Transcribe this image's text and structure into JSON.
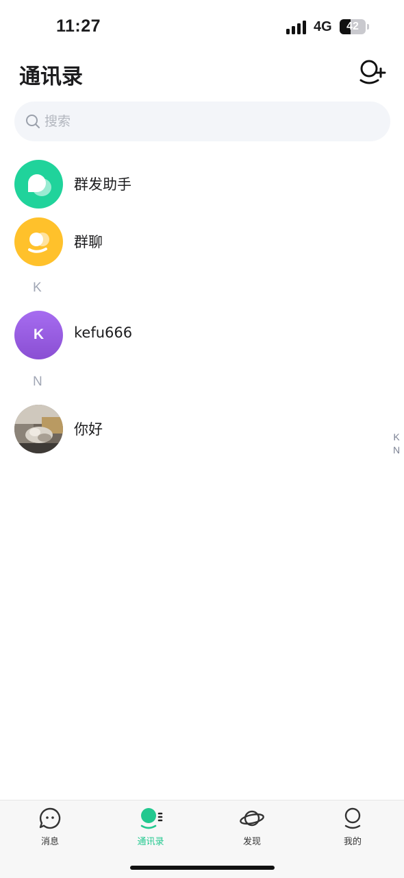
{
  "status_bar": {
    "time": "11:27",
    "network": "4G",
    "battery": "42",
    "battery_level": 0.42
  },
  "header": {
    "title": "通讯录",
    "add_icon": "add-person-icon"
  },
  "search": {
    "placeholder": "搜索",
    "value": ""
  },
  "contacts": {
    "fixed": [
      {
        "label": "群发助手",
        "icon": "broadcast-bubble-icon",
        "color": "#20d39b"
      },
      {
        "label": "群聊",
        "icon": "group-chat-icon",
        "color": "#ffc12b"
      }
    ],
    "sections": [
      {
        "letter": "K",
        "items": [
          {
            "label": "kefu666",
            "avatar_text": "K",
            "color": "#9b5fe0"
          }
        ]
      },
      {
        "letter": "N",
        "items": [
          {
            "label": "你好",
            "avatar": "photo"
          }
        ]
      }
    ]
  },
  "index_bar": [
    "K",
    "N"
  ],
  "tabs": [
    {
      "label": "消息",
      "icon": "chat-bubble-icon",
      "active": false
    },
    {
      "label": "通讯录",
      "icon": "contacts-icon",
      "active": true
    },
    {
      "label": "发现",
      "icon": "planet-icon",
      "active": false
    },
    {
      "label": "我的",
      "icon": "profile-icon",
      "active": false
    }
  ],
  "colors": {
    "accent": "#22c88f",
    "search_bg": "#f3f5f9",
    "section_letter": "#a0a6b4"
  }
}
